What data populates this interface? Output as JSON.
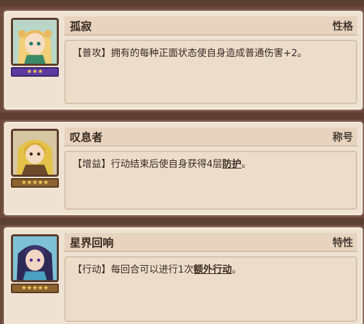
{
  "traits": [
    {
      "name": "孤寂",
      "type": "性格",
      "stars": "★★★",
      "star_count": 3,
      "desc_pre": "【普攻】拥有的每种正面状态使自身造成普通伤害+2。",
      "desc_kw": "",
      "desc_post": ""
    },
    {
      "name": "叹息者",
      "type": "称号",
      "stars": "★★★★★",
      "star_count": 5,
      "desc_pre": "【增益】行动结束后使自身获得4层",
      "desc_kw": "防护",
      "desc_post": "。"
    },
    {
      "name": "星界回响",
      "type": "特性",
      "stars": "★★★★★",
      "star_count": 5,
      "desc_pre": "【行动】每回合可以进行1次",
      "desc_kw": "额外行动",
      "desc_post": "。"
    }
  ]
}
